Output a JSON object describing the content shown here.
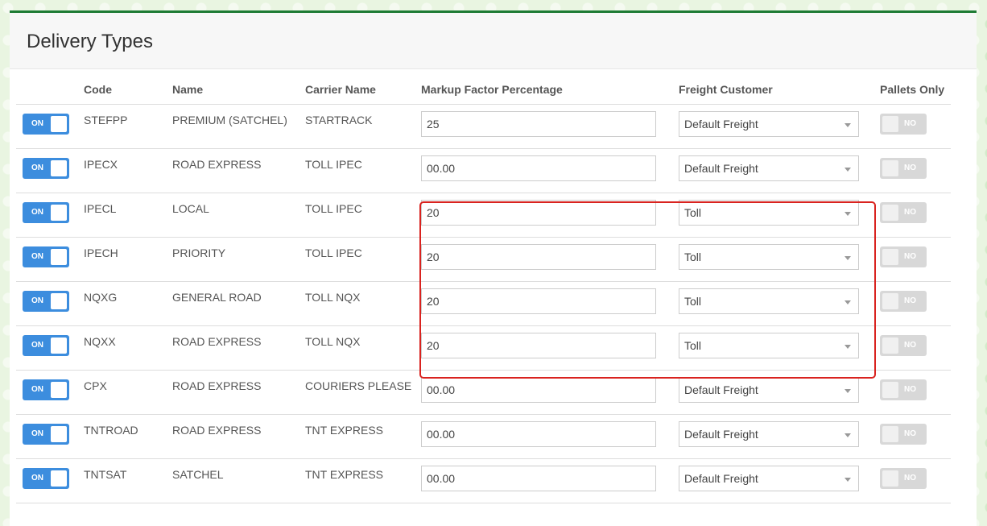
{
  "page": {
    "title": "Delivery Types"
  },
  "columns": {
    "code": "Code",
    "name": "Name",
    "carrier": "Carrier Name",
    "markup": "Markup Factor Percentage",
    "freight": "Freight Customer",
    "pallets": "Pallets Only"
  },
  "toggle_labels": {
    "on": "ON",
    "off": "NO"
  },
  "rows": [
    {
      "enabled": true,
      "code": "STEFPP",
      "name": "PREMIUM (SATCHEL)",
      "carrier": "STARTRACK",
      "markup": "25",
      "freight": "Default Freight",
      "pallets_only": false
    },
    {
      "enabled": true,
      "code": "IPECX",
      "name": "ROAD EXPRESS",
      "carrier": "TOLL IPEC",
      "markup": "00.00",
      "freight": "Default Freight",
      "pallets_only": false
    },
    {
      "enabled": true,
      "code": "IPECL",
      "name": "LOCAL",
      "carrier": "TOLL IPEC",
      "markup": "20",
      "freight": "Toll",
      "pallets_only": false
    },
    {
      "enabled": true,
      "code": "IPECH",
      "name": "PRIORITY",
      "carrier": "TOLL IPEC",
      "markup": "20",
      "freight": "Toll",
      "pallets_only": false
    },
    {
      "enabled": true,
      "code": "NQXG",
      "name": "GENERAL ROAD",
      "carrier": "TOLL NQX",
      "markup": "20",
      "freight": "Toll",
      "pallets_only": false
    },
    {
      "enabled": true,
      "code": "NQXX",
      "name": "ROAD EXPRESS",
      "carrier": "TOLL NQX",
      "markup": "20",
      "freight": "Toll",
      "pallets_only": false
    },
    {
      "enabled": true,
      "code": "CPX",
      "name": "ROAD EXPRESS",
      "carrier": "COURIERS PLEASE",
      "markup": "00.00",
      "freight": "Default Freight",
      "pallets_only": false
    },
    {
      "enabled": true,
      "code": "TNTROAD",
      "name": "ROAD EXPRESS",
      "carrier": "TNT EXPRESS",
      "markup": "00.00",
      "freight": "Default Freight",
      "pallets_only": false
    },
    {
      "enabled": true,
      "code": "TNTSAT",
      "name": "SATCHEL",
      "carrier": "TNT EXPRESS",
      "markup": "00.00",
      "freight": "Default Freight",
      "pallets_only": false
    }
  ],
  "colors": {
    "header_accent": "#1e7b34",
    "toggle_on": "#3c8dde",
    "toggle_off": "#d8d8d8",
    "highlight": "#d9231f"
  }
}
